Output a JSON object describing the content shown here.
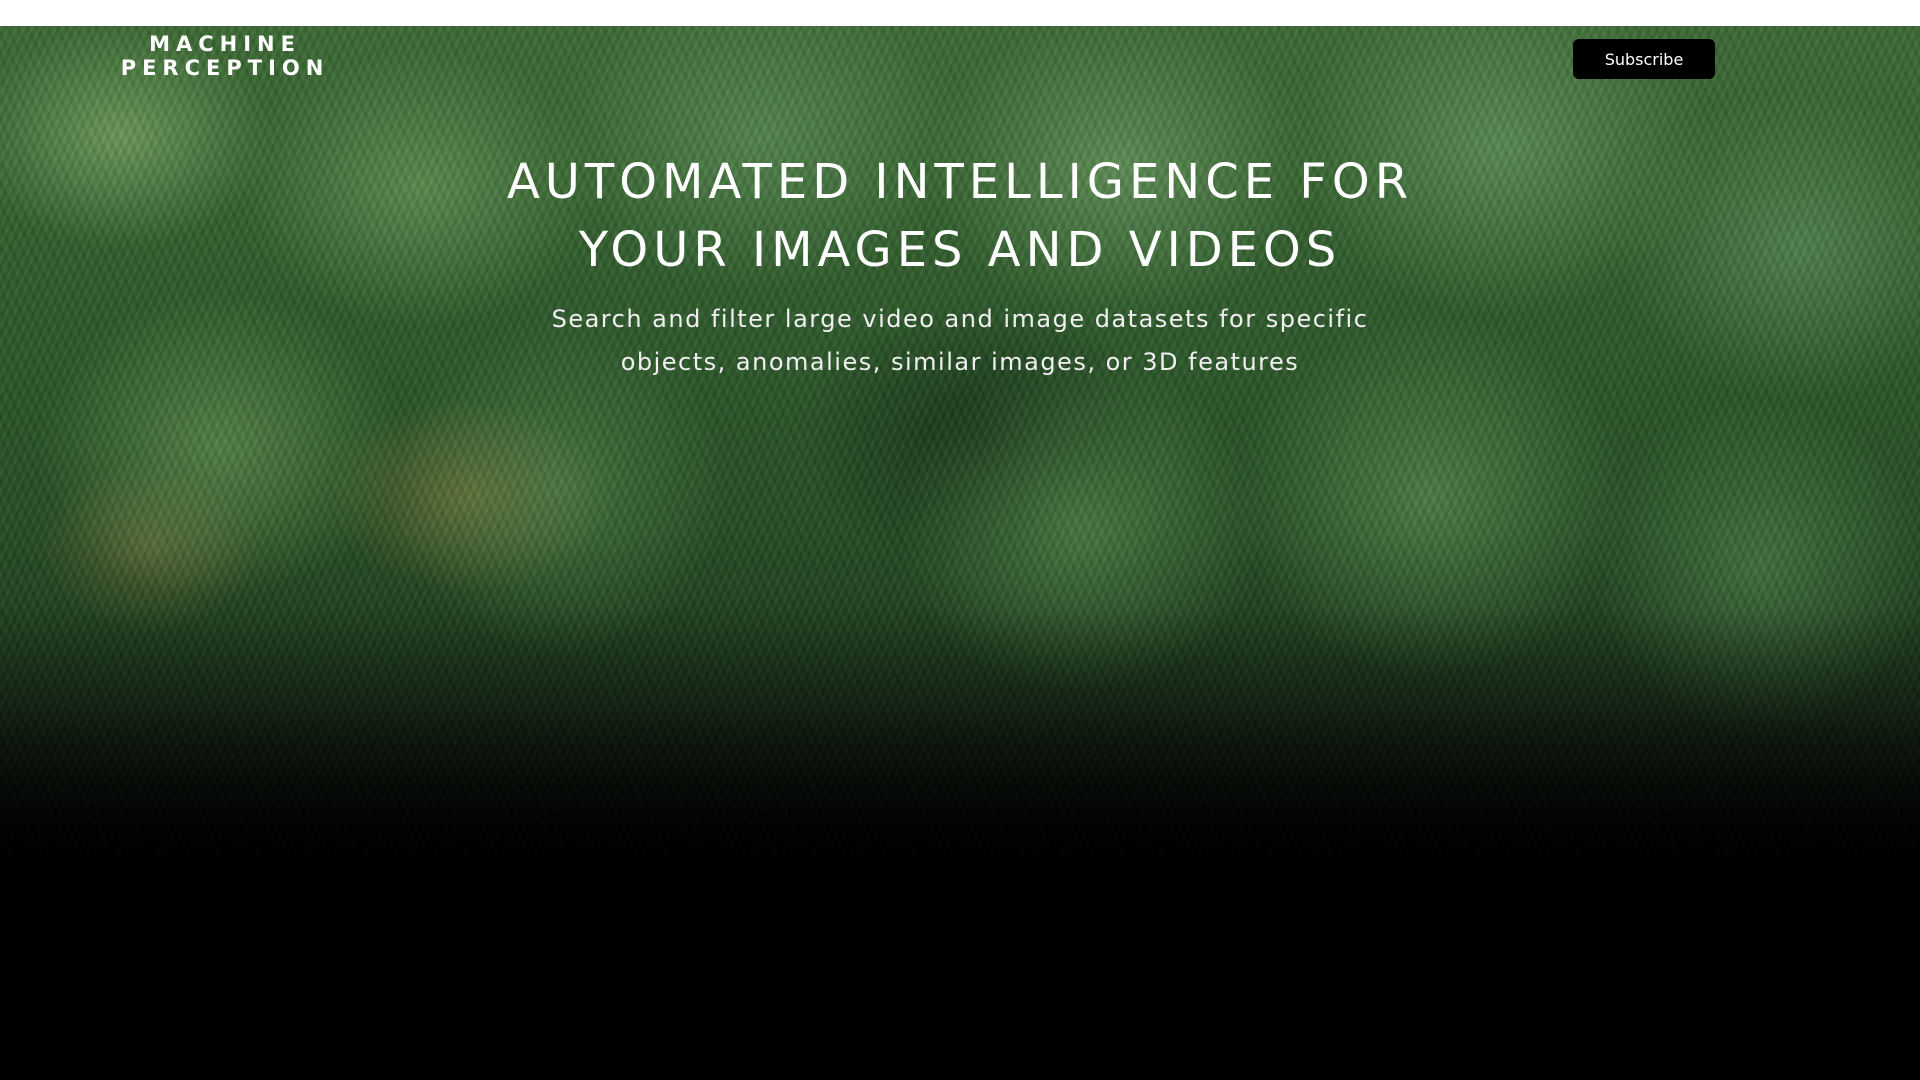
{
  "header": {
    "logo_line1": "MACHINE",
    "logo_line2": "PERCEPTION",
    "subscribe_label": "Subscribe"
  },
  "hero": {
    "headline_line1": "AUTOMATED INTELLIGENCE FOR",
    "headline_line2": "YOUR IMAGES AND VIDEOS",
    "subheadline_line1": "Search and filter large video and image datasets for specific",
    "subheadline_line2": "objects, anomalies, similar images, or 3D features",
    "background_image": "forest-canopy"
  },
  "colors": {
    "button_bg": "#000000",
    "text": "#ffffff",
    "page_bg": "#000000",
    "top_strip": "#ffffff"
  }
}
